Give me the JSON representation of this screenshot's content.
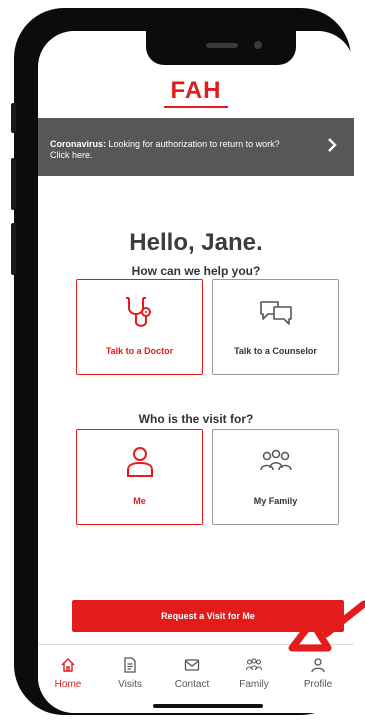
{
  "brand": {
    "logo_text": "FAH",
    "accent": "#e31b1b",
    "banner_bg": "#555759"
  },
  "banner": {
    "bold": "Coronavirus:",
    "text": " Looking for authorization to return to work? Click here.",
    "chevron_icon": "chevron-right-icon"
  },
  "greeting": {
    "title": "Hello, Jane.",
    "subtitle": "How can we help you?"
  },
  "services": [
    {
      "label": "Talk to a Doctor",
      "icon": "stethoscope-icon",
      "selected": true
    },
    {
      "label": "Talk to a Counselor",
      "icon": "chat-bubbles-icon",
      "selected": false
    }
  ],
  "visit_question": "Who is the visit for?",
  "patients": [
    {
      "label": "Me",
      "icon": "person-icon",
      "selected": true
    },
    {
      "label": "My Family",
      "icon": "family-icon",
      "selected": false
    }
  ],
  "cta_label": "Request a Visit for Me",
  "tabs": [
    {
      "label": "Home",
      "icon": "home-icon",
      "active": true
    },
    {
      "label": "Visits",
      "icon": "document-icon",
      "active": false
    },
    {
      "label": "Contact",
      "icon": "envelope-icon",
      "active": false
    },
    {
      "label": "Family",
      "icon": "family-icon",
      "active": false
    },
    {
      "label": "Profile",
      "icon": "profile-icon",
      "active": false
    }
  ]
}
